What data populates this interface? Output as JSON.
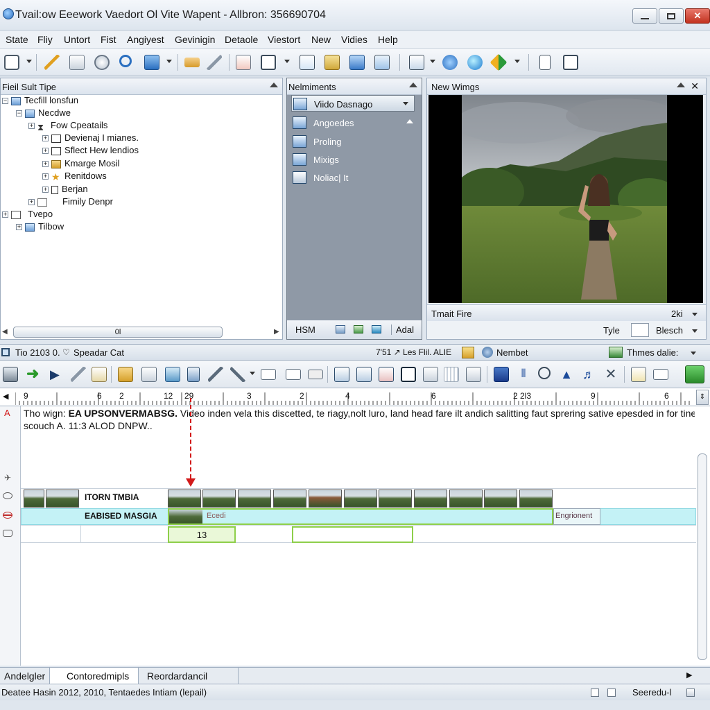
{
  "window": {
    "title": "Tvail:ow Eeework Vaedort Ol Vite Wapent - Allbron: 356690704"
  },
  "menu": [
    "State",
    "Fliy",
    "Untort",
    "Fist",
    "Angiyest",
    "Gevinigin",
    "Detaole",
    "Viestort",
    "New",
    "Vidies",
    "Help"
  ],
  "left_panel": {
    "title": "Fieil Sult Tipe",
    "tree": [
      {
        "label": "Tecfill lonsfun"
      },
      {
        "label": "Necdwe"
      },
      {
        "label": "Fow Cpeatails"
      },
      {
        "label": "Devienaj I mianes."
      },
      {
        "label": "Sflect Hew lendios"
      },
      {
        "label": "Kmarge Mosil"
      },
      {
        "label": "Renitdows"
      },
      {
        "label": "Berjan"
      },
      {
        "label": "Fimily Denpr"
      },
      {
        "label": "Tvepo"
      },
      {
        "label": "Tilbow"
      }
    ],
    "scroll_label": "0l"
  },
  "mid_panel": {
    "title": "Nelmiments",
    "selected": "Viido Dasnago",
    "items": [
      "Angoedes",
      "Proling",
      "Mixigs",
      "Noliac| It"
    ],
    "bottom": {
      "left": "HSM",
      "right": "Adal"
    }
  },
  "preview": {
    "title": "New Wimgs",
    "caption": "Tmait Fire",
    "caption_value": "2ki",
    "type_label": "Tyle",
    "type_value": "Blesch"
  },
  "timeline_header": {
    "left": "Tio 2103 0.",
    "label": "Speadar Cat",
    "mid": "7'51 ↗ Les Flil. ALIE",
    "member": "Nembet",
    "themes": "Thmes dalie:"
  },
  "ruler": [
    "9",
    "6",
    "2",
    "12",
    "29",
    "3",
    "2",
    "4",
    "6",
    "2 2l3",
    "9",
    "6"
  ],
  "timeline": {
    "text_prefix": "Tho wign:",
    "text_bold": "EA UPSONVERMABSG.",
    "text_body": "Video inden vela this discetted, te riagy,nolt luro, land head fare ilt andich salitting faut sprering sative epesded in for tine",
    "text_line2": "scouch A. 11:3 ALOD DNPW..",
    "track1_label": "ITORN TMBIA",
    "track2_label": "EABISED MASGIA",
    "track2_clip": "Ecedi",
    "track2_end": "Engrionent",
    "track3_value": "13"
  },
  "tabs": [
    "Andelgler",
    "Contoredmipls",
    "Reordardancil"
  ],
  "status": {
    "left": "Deatee Hasin 2012, 2010, Tentaedes Intiam (lepail)",
    "right": "Seeredu-l"
  },
  "colors": {
    "accent": "#2a6fc0",
    "mid_panel": "#8f99a6",
    "track_cyan": "#c4f2f6",
    "clip_green": "#8ecf4a",
    "playhead": "#d21a1a"
  }
}
